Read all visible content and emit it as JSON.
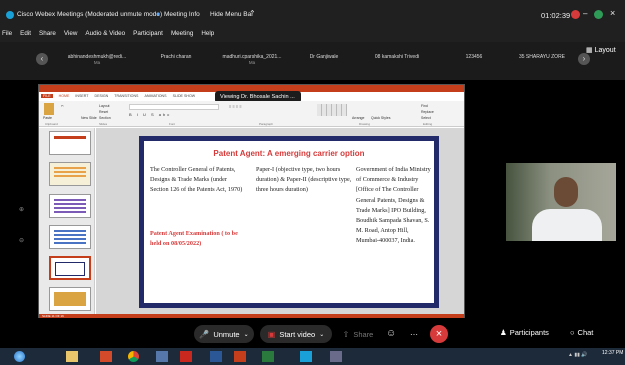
{
  "window": {
    "title": "Cisco Webex Meetings (Moderated unmute mode)",
    "meeting_info": "Meeting Info",
    "hide_menu": "Hide Menu Bar",
    "time": "01:02:39"
  },
  "menu": [
    "File",
    "Edit",
    "Share",
    "View",
    "Audio & Video",
    "Participant",
    "Meeting",
    "Help"
  ],
  "participants": [
    {
      "name": "abhinandeshmukh@redi...",
      "sub": "Ma"
    },
    {
      "name": "Prachi charan",
      "sub": ""
    },
    {
      "name": "madhuri.cparshika_2021...",
      "sub": "Ma"
    },
    {
      "name": "Dr Ganjiwale",
      "sub": ""
    },
    {
      "name": "08 kamakshi Trivedi",
      "sub": ""
    },
    {
      "name": "123456",
      "sub": ""
    },
    {
      "name": "35 SHARAYU ZORE",
      "sub": ""
    }
  ],
  "layout_label": "Layout",
  "viewing_label": "Viewing Dr. Bhosale Sachin ...",
  "ppt": {
    "tabs": [
      "FILE",
      "HOME",
      "INSERT",
      "DESIGN",
      "TRANSITIONS",
      "ANIMATIONS",
      "SLIDE SHOW"
    ],
    "groups": [
      "Clipboard",
      "Slides",
      "Font",
      "Paragraph",
      "Drawing",
      "Editing"
    ],
    "buttons": [
      "Paste",
      "New Slide",
      "Layout",
      "Reset",
      "Section",
      "Arrange",
      "Quick Styles",
      "Find",
      "Replace",
      "Select"
    ],
    "status": "SLIDE 11 OF 16"
  },
  "slide": {
    "title": "Patent Agent: A emerging carrier option",
    "col1": "The Controller General of Patents, Designs & Trade Marks (under Section 126 of the Patents Act, 1970)",
    "col1_red": "Patent Agent Examination ( to be held on 08/05/2022)",
    "col2": "Paper-I (objective type, two hours duration) & Paper-II (descriptive type, three hours duration)",
    "col3": "Government of India Ministry of Commerce & Industry [Office of The Controller General Patents, Designs & Trade Marks] IPO Building, Boudhik Sampada Shavan, S. M. Road, Antop Hill, Mumbai-400037, India."
  },
  "controls": {
    "unmute": "Unmute",
    "start_video": "Start video",
    "share": "Share",
    "participants": "Participants",
    "chat": "Chat"
  },
  "taskbar": {
    "time": "12:37 PM"
  },
  "colors": {
    "accent_red": "#d73a3a",
    "slide_border": "#232a6a",
    "webex_bg": "#202020"
  }
}
